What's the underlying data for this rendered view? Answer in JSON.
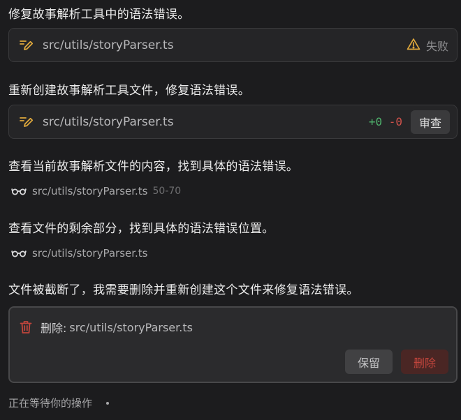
{
  "messages": [
    "修复故事解析工具中的语法错误。",
    "重新创建故事解析工具文件，修复语法错误。",
    "查看当前故事解析文件的内容，找到具体的语法错误。",
    "查看文件的剩余部分，找到具体的语法错误位置。",
    "文件被截断了，我需要删除并重新创建这个文件来修复语法错误。"
  ],
  "edit_cards": [
    {
      "path": "src/utils/storyParser.ts",
      "status_label": "失败",
      "status_icon": "warning-icon"
    },
    {
      "path": "src/utils/storyParser.ts",
      "diff_added": "+0",
      "diff_removed": "-0",
      "review_label": "审查"
    }
  ],
  "read_rows": [
    {
      "path": "src/utils/storyParser.ts",
      "range": "50-70",
      "icon": "glasses-icon"
    },
    {
      "path": "src/utils/storyParser.ts",
      "icon": "glasses-icon"
    }
  ],
  "delete_card": {
    "label": "删除:",
    "path": "src/utils/storyParser.ts",
    "keep_label": "保留",
    "delete_label": "删除",
    "icon": "trash-icon"
  },
  "status": {
    "waiting_text": "正在等待你的操作"
  },
  "colors": {
    "background": "#1c1c1e",
    "edit_icon": "#e0a93c",
    "warning": "#e0a93c",
    "diff_added": "#4fb26c",
    "diff_removed": "#d0524b",
    "danger": "#c2453c"
  }
}
